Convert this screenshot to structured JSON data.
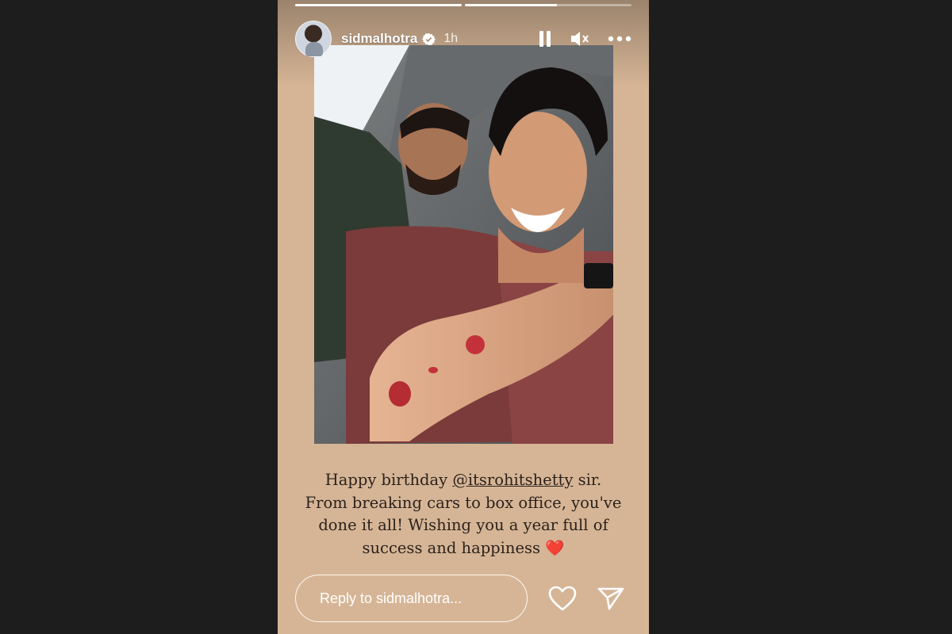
{
  "story": {
    "progress": [
      1.0,
      0.55
    ],
    "username": "sidmalhotra",
    "time_ago": "1h",
    "verified": true,
    "caption": {
      "line1_prefix": "Happy birthday ",
      "mention": "@itsrohitshetty",
      "line1_suffix": " sir.",
      "line2": "From breaking cars to box office, you've",
      "line3": "done it all! Wishing you a year full of",
      "line4": "success and happiness ",
      "emoji": "❤️"
    },
    "reply_placeholder": "Reply to sidmalhotra...",
    "icons": {
      "pause": "pause-icon",
      "mute": "mute-icon",
      "more": "more-icon",
      "like": "heart-icon",
      "share": "send-icon"
    },
    "colors": {
      "background": "#d6b596",
      "side": "#1d1d1d",
      "caption_text": "#2b221c"
    }
  }
}
